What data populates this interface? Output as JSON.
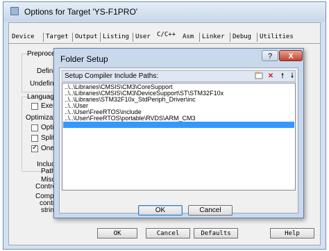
{
  "window": {
    "title": "Options for Target 'YS-F1PRO'"
  },
  "tabs": [
    "Device",
    "Target",
    "Output",
    "Listing",
    "User",
    "C/C++",
    "Asm",
    "Linker",
    "Debug",
    "Utilities"
  ],
  "active_tab": "C/C++",
  "background": {
    "preprocessor": "Preproces",
    "define": "Define",
    "undefine": "Undefine",
    "language": "Language",
    "execute": "Execu",
    "optimization": "Optimizatio",
    "optimize": "Optimi",
    "split": "Split L",
    "one_elf": "One E",
    "include_paths": [
      "Include",
      "Paths"
    ],
    "misc_controls": [
      "Misc",
      "Controls"
    ],
    "compiler_control_string": [
      "Compiler",
      "control",
      "string"
    ]
  },
  "bottom_buttons": {
    "ok": "OK",
    "cancel": "Cancel",
    "defaults": "Defaults",
    "help": "Help"
  },
  "dialog": {
    "title": "Folder Setup",
    "help_glyph": "?",
    "close_glyph": "X",
    "header_label": "Setup Compiler Include Paths:",
    "toolbar": {
      "new": "new-folder-icon",
      "delete": "delete-icon",
      "up": "move-up-icon",
      "down": "move-down-icon"
    },
    "paths": [
      "..\\..\\Libraries\\CMSIS\\CM3\\CoreSupport",
      "..\\..\\Libraries\\CMSIS\\CM3\\DeviceSupport\\ST\\STM32F10x",
      "..\\..\\Libraries\\STM32F10x_StdPeriph_Driver\\inc",
      "..\\..\\User",
      "..\\..\\User\\FreeRTOS\\include",
      "..\\..\\User\\FreeRTOS\\portable\\RVDS\\ARM_CM3",
      ""
    ],
    "selected_index": 6,
    "ok": "OK",
    "cancel": "Cancel"
  },
  "colors": {
    "selection": "#3399ff",
    "title_bg": "#d3e0ef",
    "close": "#c2422c"
  }
}
